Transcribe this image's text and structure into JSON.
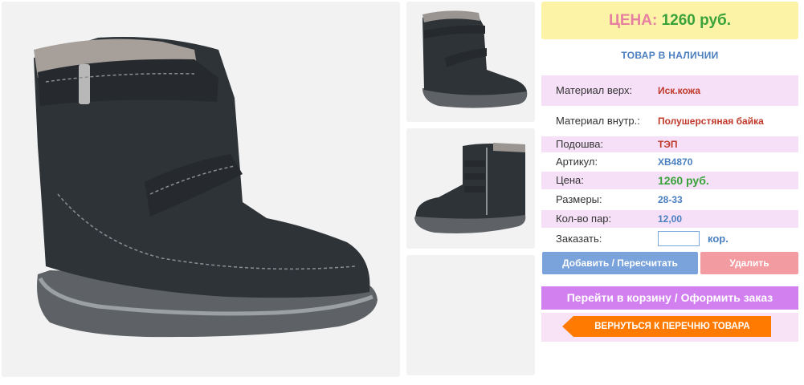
{
  "price_header": {
    "label": "ЦЕНА:",
    "value": "1260 руб."
  },
  "stock_status": "ТОВАР В НАЛИЧИИ",
  "properties": {
    "material_top": {
      "label": "Материал верх:",
      "value": "Иск.кожа"
    },
    "material_inner": {
      "label": "Материал внутр.:",
      "value": "Полушерстяная байка"
    },
    "sole": {
      "label": "Подошва:",
      "value": "ТЭП"
    },
    "article": {
      "label": "Артикул:",
      "value": "XB4870"
    },
    "price": {
      "label": "Цена:",
      "value": "1260 руб."
    },
    "sizes": {
      "label": "Размеры:",
      "value": "28-33"
    },
    "pairs": {
      "label": "Кол-во пар:",
      "value": "12,00"
    },
    "order": {
      "label": "Заказать:",
      "quantity": "",
      "unit": "кор."
    }
  },
  "buttons": {
    "add": "Добавить / Пересчитать",
    "delete": "Удалить",
    "cart": "Перейти в корзину / Оформить заказ",
    "back": "ВЕРНУТЬСЯ К ПЕРЕЧНЮ ТОВАРА"
  },
  "colors": {
    "price_bg": "#fdf3a6",
    "price_label": "#e680a0",
    "price_value": "#3aa23a",
    "accent_blue": "#4a7fc0",
    "row_pink": "#f6e0f7",
    "button_add": "#7aa3dc",
    "button_delete": "#f29ca2",
    "button_cart": "#d27ff0",
    "button_back": "#ff7a00"
  }
}
